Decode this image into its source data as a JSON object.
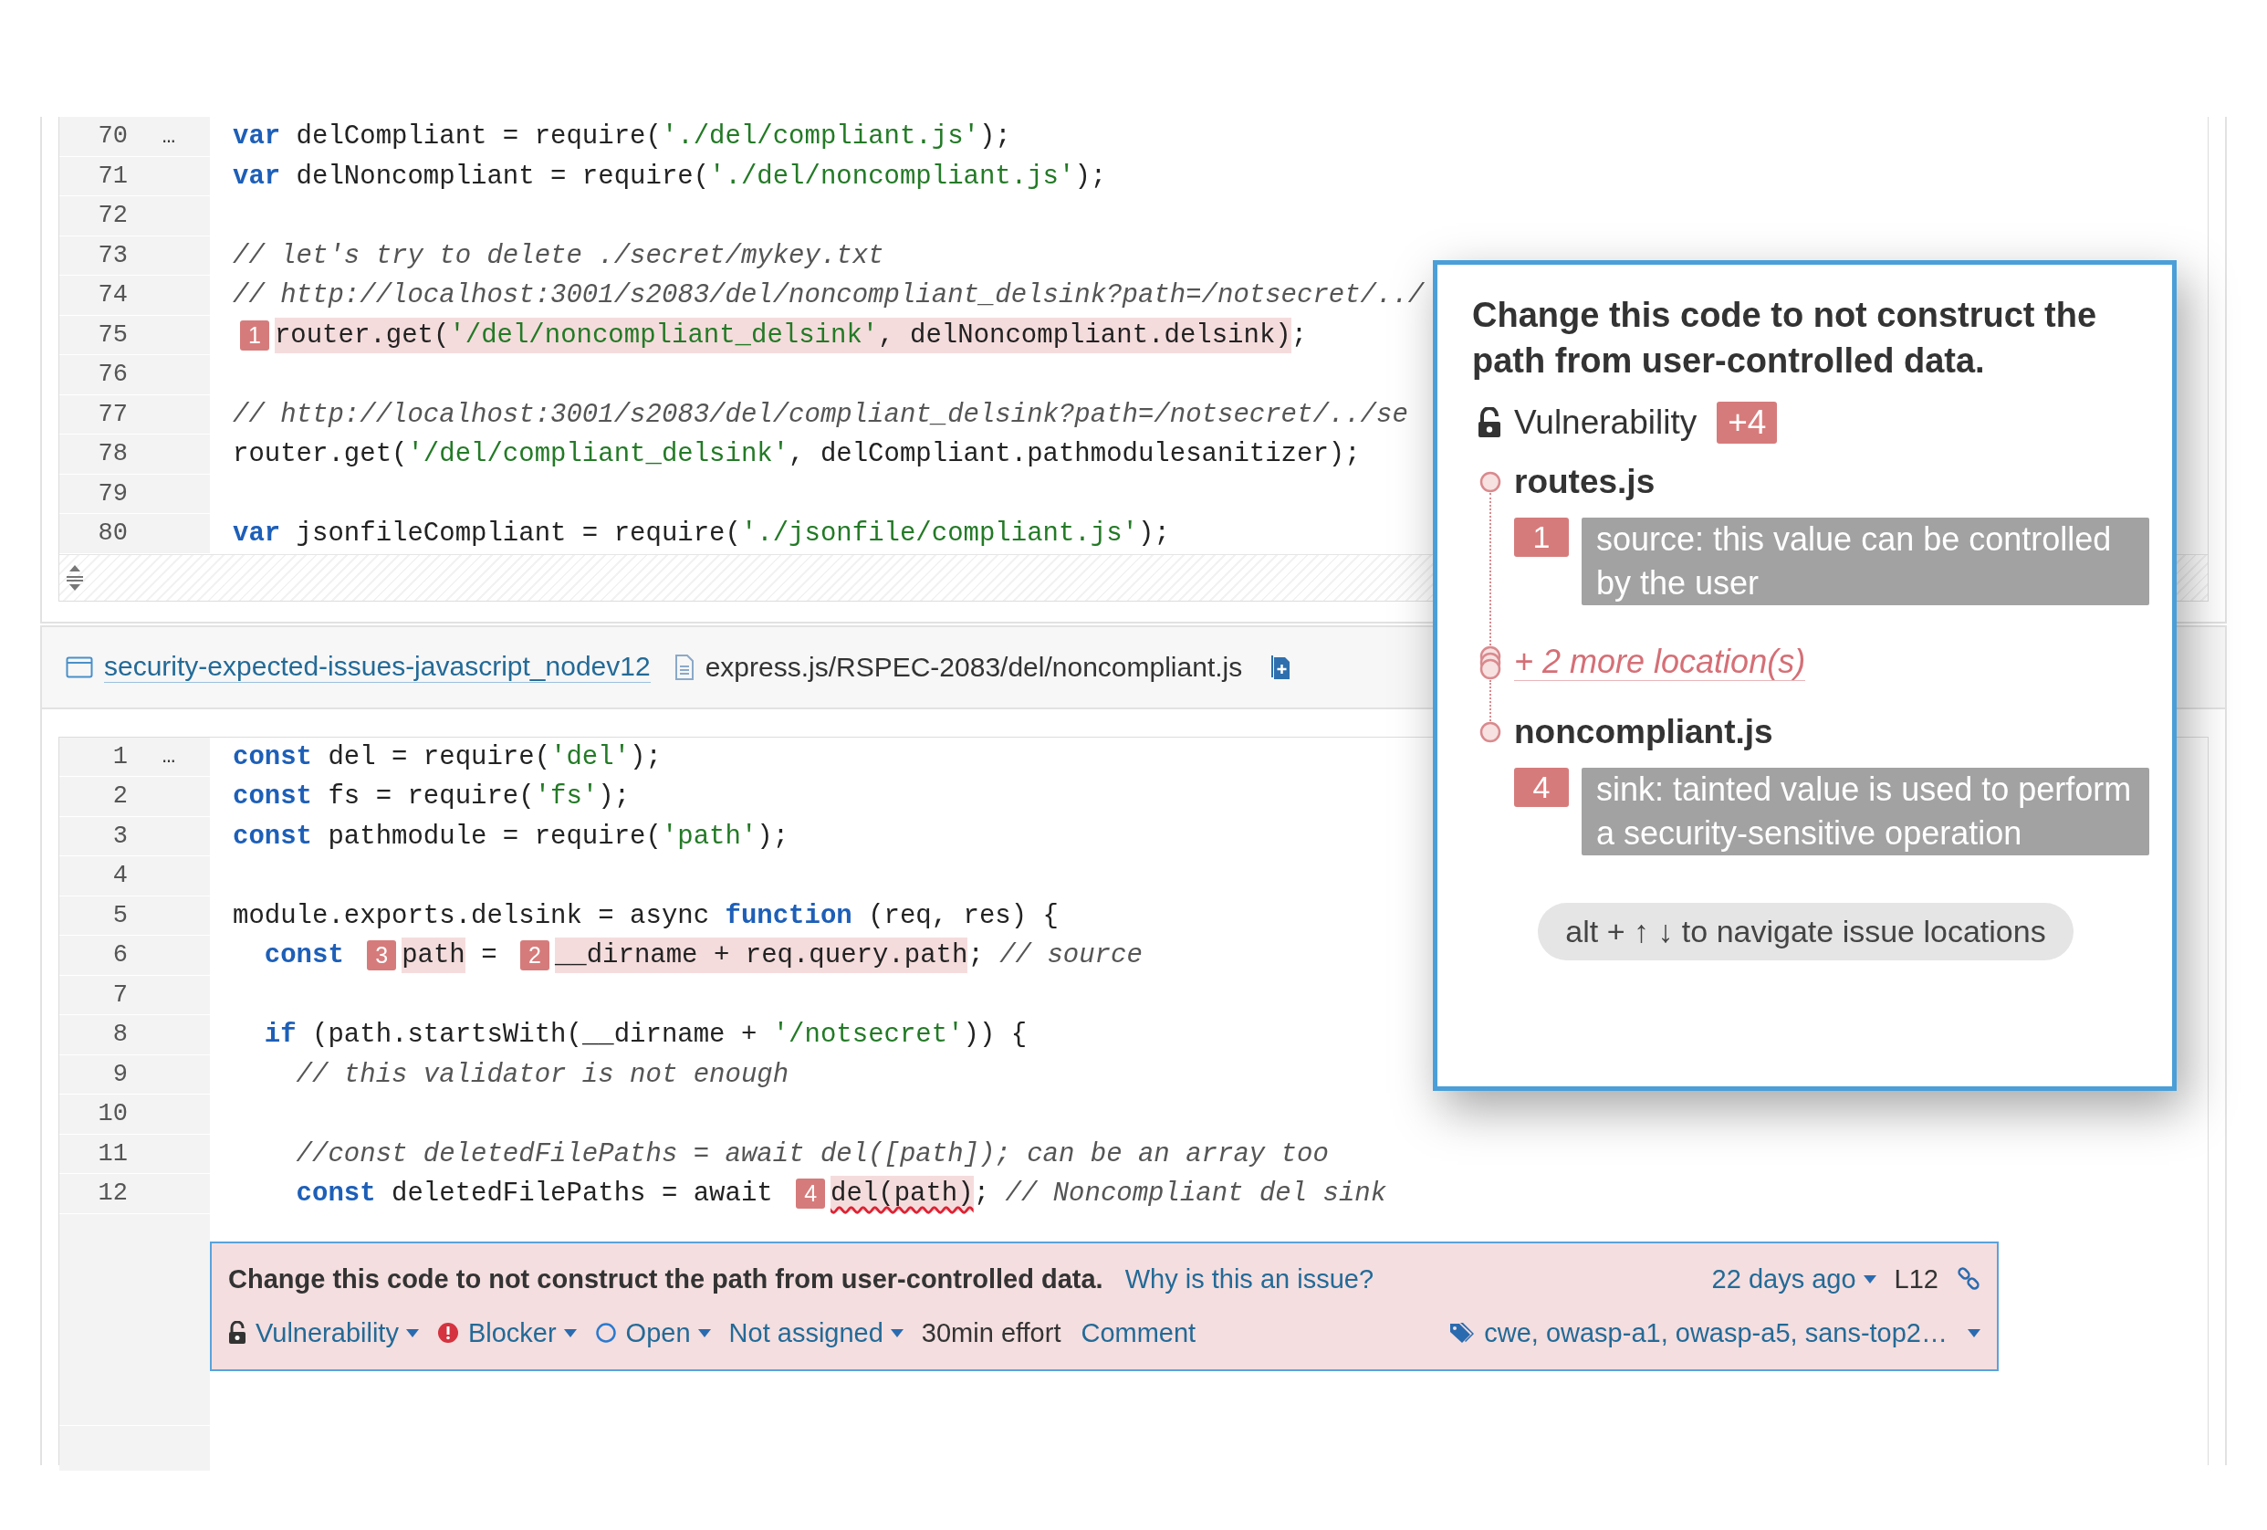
{
  "top_snippet": {
    "lines": [
      {
        "number": "70",
        "gutter_mark": "…",
        "tokens": [
          {
            "kind": "keyword",
            "text": "var"
          },
          {
            "kind": "plain",
            "text": " delCompliant = require("
          },
          {
            "kind": "string",
            "text": "'./del/compliant.js'"
          },
          {
            "kind": "plain",
            "text": ");"
          }
        ]
      },
      {
        "number": "71",
        "tokens": [
          {
            "kind": "keyword",
            "text": "var"
          },
          {
            "kind": "plain",
            "text": " delNoncompliant = require("
          },
          {
            "kind": "string",
            "text": "'./del/noncompliant.js'"
          },
          {
            "kind": "plain",
            "text": ");"
          }
        ]
      },
      {
        "number": "72"
      },
      {
        "number": "73",
        "tokens": [
          {
            "kind": "comment",
            "text": "// let's try to delete ./secret/mykey.txt"
          }
        ]
      },
      {
        "number": "74",
        "tokens": [
          {
            "kind": "comment",
            "text": "// http://localhost:3001/s2083/del/noncompliant_delsink?path=/notsecret/../"
          }
        ]
      },
      {
        "number": "75",
        "tokens": [
          {
            "kind": "marker",
            "text": "1"
          },
          {
            "kind": "range",
            "squiggle": false,
            "tokens": [
              {
                "kind": "plain",
                "text": "router.get("
              },
              {
                "kind": "string",
                "text": "'/del/noncompliant_delsink'"
              },
              {
                "kind": "plain",
                "text": ", delNoncompliant.delsink)"
              }
            ]
          },
          {
            "kind": "plain",
            "text": ";"
          }
        ]
      },
      {
        "number": "76"
      },
      {
        "number": "77",
        "tokens": [
          {
            "kind": "comment",
            "text": "// http://localhost:3001/s2083/del/compliant_delsink?path=/notsecret/../se"
          }
        ]
      },
      {
        "number": "78",
        "tokens": [
          {
            "kind": "plain",
            "text": "router.get("
          },
          {
            "kind": "string",
            "text": "'/del/compliant_delsink'"
          },
          {
            "kind": "plain",
            "text": ", delCompliant.pathmodulesanitizer);"
          }
        ]
      },
      {
        "number": "79"
      },
      {
        "number": "80",
        "tokens": [
          {
            "kind": "keyword",
            "text": "var"
          },
          {
            "kind": "plain",
            "text": " jsonfileCompliant = require("
          },
          {
            "kind": "string",
            "text": "'./jsonfile/compliant.js'"
          },
          {
            "kind": "plain",
            "text": ");"
          }
        ]
      }
    ]
  },
  "file_header": {
    "project": "security-expected-issues-javascript_nodev12",
    "file": "express.js/RSPEC-2083/del/noncompliant.js"
  },
  "bottom_snippet": {
    "lines": [
      {
        "number": "1",
        "gutter_mark": "…",
        "tokens": [
          {
            "kind": "keyword",
            "text": "const"
          },
          {
            "kind": "plain",
            "text": " del = require("
          },
          {
            "kind": "string",
            "text": "'del'"
          },
          {
            "kind": "plain",
            "text": ");"
          }
        ]
      },
      {
        "number": "2",
        "tokens": [
          {
            "kind": "keyword",
            "text": "const"
          },
          {
            "kind": "plain",
            "text": " fs = require("
          },
          {
            "kind": "string",
            "text": "'fs'"
          },
          {
            "kind": "plain",
            "text": ");"
          }
        ]
      },
      {
        "number": "3",
        "tokens": [
          {
            "kind": "keyword",
            "text": "const"
          },
          {
            "kind": "plain",
            "text": " pathmodule = require("
          },
          {
            "kind": "string",
            "text": "'path'"
          },
          {
            "kind": "plain",
            "text": ");"
          }
        ]
      },
      {
        "number": "4"
      },
      {
        "number": "5",
        "tokens": [
          {
            "kind": "plain",
            "text": "module.exports.delsink = async "
          },
          {
            "kind": "keyword",
            "text": "function"
          },
          {
            "kind": "plain",
            "text": " (req, res) {"
          }
        ]
      },
      {
        "number": "6",
        "tokens": [
          {
            "kind": "keyword",
            "text": "  const "
          },
          {
            "kind": "marker",
            "text": "3"
          },
          {
            "kind": "range",
            "squiggle": false,
            "tokens": [
              {
                "kind": "plain",
                "text": "path"
              }
            ]
          },
          {
            "kind": "plain",
            "text": " = "
          },
          {
            "kind": "marker",
            "text": "2"
          },
          {
            "kind": "range",
            "squiggle": false,
            "tokens": [
              {
                "kind": "plain",
                "text": "__dirname + req.query.path"
              }
            ]
          },
          {
            "kind": "plain",
            "text": "; "
          },
          {
            "kind": "comment",
            "text": "// source"
          }
        ]
      },
      {
        "number": "7"
      },
      {
        "number": "8",
        "tokens": [
          {
            "kind": "keyword",
            "text": "  if"
          },
          {
            "kind": "plain",
            "text": " (path.startsWith(__dirname + "
          },
          {
            "kind": "string",
            "text": "'/notsecret'"
          },
          {
            "kind": "plain",
            "text": ")) {"
          }
        ]
      },
      {
        "number": "9",
        "tokens": [
          {
            "kind": "comment",
            "text": "    // this validator is not enough"
          }
        ]
      },
      {
        "number": "10"
      },
      {
        "number": "11",
        "tokens": [
          {
            "kind": "comment",
            "text": "    //const deletedFilePaths = await del([path]); can be an array too"
          }
        ]
      },
      {
        "number": "12",
        "tokens": [
          {
            "kind": "keyword",
            "text": "    const"
          },
          {
            "kind": "plain",
            "text": " deletedFilePaths = await "
          },
          {
            "kind": "marker",
            "text": "4"
          },
          {
            "kind": "range",
            "squiggle": true,
            "tokens": [
              {
                "kind": "plain",
                "text": "del(path)"
              }
            ]
          },
          {
            "kind": "plain",
            "text": "; "
          },
          {
            "kind": "comment",
            "text": "// Noncompliant del sink"
          }
        ]
      }
    ]
  },
  "issue": {
    "title": "Change this code to not construct the path from user-controlled data.",
    "why_link": "Why is this an issue?",
    "age": "22 days ago",
    "line": "L12",
    "type": "Vulnerability",
    "severity": "Blocker",
    "status": "Open",
    "assignee": "Not assigned",
    "effort": "30min effort",
    "comment": "Comment",
    "tags": "cwe, owasp-a1, owasp-a5, sans-top2…"
  },
  "popup": {
    "title": "Change this code to not construct the path from user-controlled data.",
    "type": "Vulnerability",
    "count": "+4",
    "flow": [
      {
        "kind": "file",
        "name": "routes.js",
        "locations": [
          {
            "number": "1",
            "message": "source: this value can be controlled by the user"
          }
        ]
      },
      {
        "kind": "more",
        "text": "+ 2 more location(s)"
      },
      {
        "kind": "file",
        "name": "noncompliant.js",
        "locations": [
          {
            "number": "4",
            "message": "sink: tainted value is used to perform a security-sensitive operation"
          }
        ]
      }
    ],
    "hint": "alt + ↑ ↓ to navigate issue locations"
  }
}
